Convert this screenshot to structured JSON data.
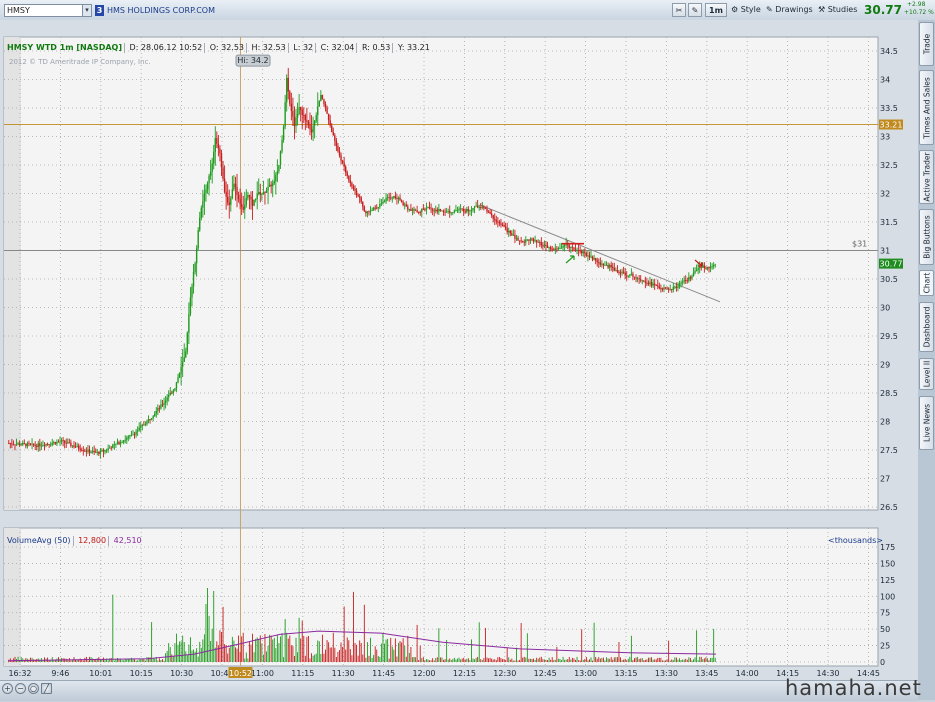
{
  "toolbar": {
    "symbol": "HMSY",
    "link_badge": "3",
    "company": "HMS HOLDINGS CORP.COM",
    "timeframe": "1m",
    "style_label": "Style",
    "drawings_label": "Drawings",
    "studies_label": "Studies",
    "last_price": "30.77",
    "change_abs": "+2.98",
    "change_pct": "+10.72 %"
  },
  "chart_header": {
    "symbol_label": "HMSY WTD 1m [NASDAQ]",
    "date": "D: 28.06.12 10:52",
    "open": "O: 32.53",
    "high": "H: 32.53",
    "low": "L: 32",
    "close": "C: 32.04",
    "range": "R: 0.53",
    "y": "Y: 33.21",
    "copyright": "2012 © TD Ameritrade IP Company, Inc."
  },
  "volume_header": {
    "study": "VolumeAvg (50)",
    "volume": "12,800",
    "average": "42,510",
    "units": "<thousands>"
  },
  "right_tabs": [
    "Trade",
    "Times And Sales",
    "Active Trader",
    "Big Buttons",
    "Chart",
    "Dashboard",
    "Level II",
    "Live News"
  ],
  "watermark": "hamaha.net",
  "chart_data": {
    "type": "candlestick",
    "symbol": "HMSY",
    "interval": "1m",
    "price_axis": {
      "ylim": [
        26.5,
        34.75
      ],
      "ticks": [
        "26.5",
        "27",
        "27.5",
        "28",
        "28.5",
        "29",
        "29.5",
        "30",
        "30.5",
        "31",
        "31.5",
        "32",
        "32.5",
        "33",
        "33.5",
        "34",
        "34.5"
      ]
    },
    "volume_axis": {
      "ylim": [
        0,
        195
      ],
      "ticks": [
        "0",
        "25",
        "50",
        "75",
        "100",
        "125",
        "150",
        "175"
      ],
      "units": "thousands"
    },
    "time_axis": {
      "labels": [
        "16:32",
        "9:46",
        "10:01",
        "10:15",
        "10:30",
        "10:45",
        "11:00",
        "11:15",
        "11:30",
        "11:45",
        "12:00",
        "12:15",
        "12:30",
        "12:45",
        "13:00",
        "13:15",
        "13:30",
        "13:45",
        "14:00",
        "14:15",
        "14:30",
        "14:45"
      ],
      "cursor_label": "10:52"
    },
    "price_lines": [
      {
        "label": "33.21",
        "value": 33.21,
        "color": "#c08a1e"
      },
      {
        "label": "$31",
        "value": 31.0,
        "color": "#888888"
      }
    ],
    "last_price_marker": {
      "label": "30.77",
      "value": 30.77,
      "color": "#1e8c1e"
    },
    "high_marker": {
      "label": "Hi: 34.2",
      "value": 34.2
    },
    "series_path": [
      [
        0,
        27.62
      ],
      [
        18,
        27.58
      ],
      [
        28,
        27.62
      ],
      [
        35,
        27.65
      ],
      [
        45,
        27.55
      ],
      [
        52,
        27.48
      ],
      [
        58,
        27.45
      ],
      [
        62,
        27.48
      ],
      [
        70,
        27.6
      ],
      [
        80,
        27.75
      ],
      [
        90,
        28.0
      ],
      [
        100,
        28.3
      ],
      [
        108,
        28.6
      ],
      [
        115,
        29.2
      ],
      [
        118,
        30.2
      ],
      [
        121,
        30.8
      ],
      [
        124,
        31.6
      ],
      [
        128,
        32.1
      ],
      [
        132,
        32.5
      ],
      [
        134,
        33.0
      ],
      [
        137,
        32.7
      ],
      [
        140,
        32.0
      ],
      [
        143,
        31.8
      ],
      [
        146,
        32.2
      ],
      [
        149,
        31.9
      ],
      [
        152,
        31.7
      ],
      [
        155,
        32.0
      ],
      [
        158,
        31.8
      ],
      [
        161,
        32.0
      ],
      [
        165,
        32.0
      ],
      [
        168,
        32.1
      ],
      [
        172,
        32.2
      ],
      [
        175,
        32.5
      ],
      [
        178,
        33.2
      ],
      [
        180,
        34.0
      ],
      [
        182,
        33.6
      ],
      [
        185,
        33.2
      ],
      [
        188,
        33.5
      ],
      [
        192,
        33.3
      ],
      [
        196,
        33.1
      ],
      [
        199,
        33.4
      ],
      [
        202,
        33.7
      ],
      [
        205,
        33.5
      ],
      [
        208,
        33.2
      ],
      [
        211,
        32.9
      ],
      [
        215,
        32.6
      ],
      [
        219,
        32.3
      ],
      [
        223,
        32.1
      ],
      [
        227,
        31.9
      ],
      [
        230,
        31.7
      ],
      [
        233,
        31.65
      ],
      [
        236,
        31.75
      ],
      [
        240,
        31.8
      ],
      [
        244,
        31.9
      ],
      [
        248,
        31.95
      ],
      [
        252,
        31.9
      ],
      [
        256,
        31.8
      ],
      [
        260,
        31.7
      ],
      [
        264,
        31.68
      ],
      [
        268,
        31.72
      ],
      [
        272,
        31.75
      ],
      [
        276,
        31.7
      ],
      [
        280,
        31.7
      ],
      [
        284,
        31.68
      ],
      [
        288,
        31.7
      ],
      [
        292,
        31.72
      ],
      [
        296,
        31.7
      ],
      [
        300,
        31.75
      ],
      [
        304,
        31.78
      ],
      [
        308,
        31.72
      ],
      [
        312,
        31.6
      ],
      [
        316,
        31.5
      ],
      [
        320,
        31.4
      ],
      [
        324,
        31.3
      ],
      [
        328,
        31.2
      ],
      [
        332,
        31.15
      ],
      [
        336,
        31.2
      ],
      [
        340,
        31.15
      ],
      [
        344,
        31.1
      ],
      [
        348,
        31.05
      ],
      [
        352,
        31.0
      ],
      [
        356,
        31.05
      ],
      [
        360,
        31.1
      ],
      [
        364,
        31.05
      ],
      [
        368,
        31.0
      ],
      [
        372,
        30.95
      ],
      [
        376,
        30.88
      ],
      [
        380,
        30.8
      ],
      [
        384,
        30.75
      ],
      [
        388,
        30.72
      ],
      [
        392,
        30.65
      ],
      [
        396,
        30.6
      ],
      [
        400,
        30.58
      ],
      [
        404,
        30.55
      ],
      [
        408,
        30.5
      ],
      [
        412,
        30.45
      ],
      [
        416,
        30.4
      ],
      [
        420,
        30.35
      ],
      [
        424,
        30.32
      ],
      [
        428,
        30.33
      ],
      [
        432,
        30.38
      ],
      [
        436,
        30.45
      ],
      [
        440,
        30.52
      ],
      [
        444,
        30.65
      ],
      [
        448,
        30.72
      ],
      [
        452,
        30.7
      ],
      [
        456,
        30.77
      ]
    ],
    "trendline": [
      [
        0.0,
        31.8
      ],
      [
        1.0,
        30.1
      ]
    ],
    "bar_count": 456
  }
}
